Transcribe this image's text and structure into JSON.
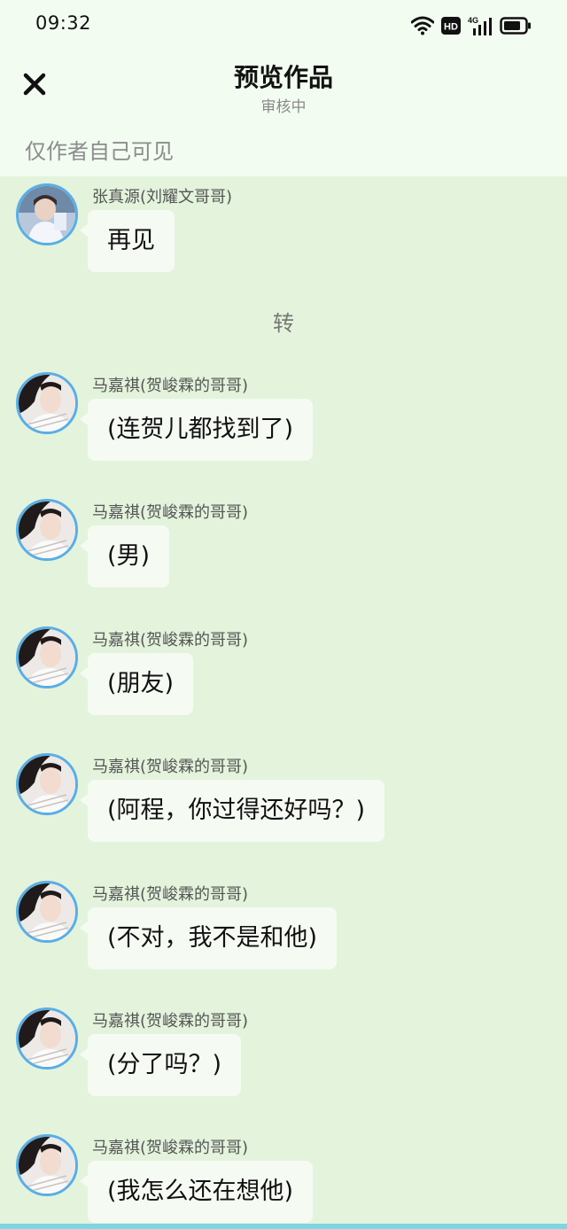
{
  "status_bar": {
    "time": "09:32",
    "hd_label": "HD",
    "network_label": "4G"
  },
  "header": {
    "close_icon": "close-icon",
    "title": "预览作品",
    "subtitle": "审核中",
    "visibility_note": "仅作者自己可见"
  },
  "chat": {
    "system_message": "转",
    "messages": [
      {
        "sender": "张真源(刘耀文哥哥)",
        "text": "再见"
      },
      {
        "sender": "马嘉祺(贺峻霖的哥哥)",
        "text": "(连贺儿都找到了)"
      },
      {
        "sender": "马嘉祺(贺峻霖的哥哥)",
        "text": "(男)"
      },
      {
        "sender": "马嘉祺(贺峻霖的哥哥)",
        "text": "(朋友)"
      },
      {
        "sender": "马嘉祺(贺峻霖的哥哥)",
        "text": "(阿程，你过得还好吗？)"
      },
      {
        "sender": "马嘉祺(贺峻霖的哥哥)",
        "text": "(不对，我不是和他)"
      },
      {
        "sender": "马嘉祺(贺峻霖的哥哥)",
        "text": "(分了吗？)"
      },
      {
        "sender": "马嘉祺(贺峻霖的哥哥)",
        "text": "(我怎么还在想他)"
      }
    ]
  },
  "colors": {
    "header_bg": "#f2fcf0",
    "chat_bg": "#e4f4dc",
    "bubble_bg": "#f5fbf3",
    "avatar_ring": "#5aaee6"
  }
}
